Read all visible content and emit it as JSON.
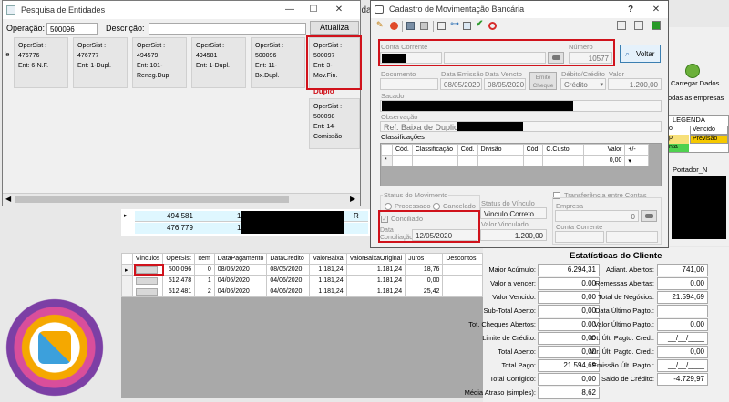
{
  "background_app": {
    "title_fragment": "lida",
    "right_panel": {
      "carregar_dados": "Carregar Dados",
      "todas_empresas": "odas as empresas",
      "legenda_title": "LEGENDA",
      "legenda_items": [
        "Vencido",
        "Previsão",
        "nta"
      ],
      "legend_left": [
        "o",
        "p"
      ],
      "portador_header": "Portador_N"
    },
    "mid_grid": {
      "rows": [
        {
          "value": "494.581",
          "qty": "1",
          "flag": "R"
        },
        {
          "value": "476.779",
          "qty": "1",
          "flag": ""
        }
      ],
      "row_marker": "▸"
    },
    "bottom_grid": {
      "columns": [
        "Vínculos",
        "OperSist",
        "Item",
        "DataPagamento",
        "DataCredito",
        "ValorBaixa",
        "ValorBaixaOriginal",
        "Juros",
        "Descontos"
      ],
      "rows": [
        {
          "opersist": "500.096",
          "item": "0",
          "datapag": "08/05/2020",
          "datacred": "08/05/2020",
          "valor": "1.181,24",
          "original": "1.181,24",
          "juros": "18,76",
          "desc": ""
        },
        {
          "opersist": "512.478",
          "item": "1",
          "datapag": "04/06/2020",
          "datacred": "04/06/2020",
          "valor": "1.181,24",
          "original": "1.181,24",
          "juros": "0,00",
          "desc": ""
        },
        {
          "opersist": "512.481",
          "item": "2",
          "datapag": "04/06/2020",
          "datacred": "04/06/2020",
          "valor": "1.181,24",
          "original": "1.181,24",
          "juros": "25,42",
          "desc": ""
        }
      ]
    },
    "stats": {
      "title": "Estatísticas do Cliente",
      "left": [
        {
          "label": "Maior Acúmulo:",
          "value": "6.294,31"
        },
        {
          "label": "Valor a vencer:",
          "value": "0,00"
        },
        {
          "label": "Valor Vencido:",
          "value": "0,00"
        },
        {
          "label": "Sub-Total Aberto:",
          "value": "0,00"
        },
        {
          "label": "Tot. Cheques Abertos:",
          "value": "0,00"
        },
        {
          "label": "Limite de Crédito:",
          "value": "0,00"
        },
        {
          "label": "Total Aberto:",
          "value": "0,00"
        },
        {
          "label": "Total Pago:",
          "value": "21.594,69"
        },
        {
          "label": "Total Corrigido:",
          "value": "0,00"
        },
        {
          "label": "Média Atraso (simples):",
          "value": "8,62"
        }
      ],
      "right": [
        {
          "label": "Adiant. Abertos:",
          "value": "741,00"
        },
        {
          "label": "Remessas Abertas:",
          "value": "0,00"
        },
        {
          "label": "Total de Negócios:",
          "value": "21.594,69"
        },
        {
          "label": "Data Último Pagto.:",
          "value": ""
        },
        {
          "label": "Valor Último Pagto.:",
          "value": "0,00"
        },
        {
          "label": "Dt. Últ. Pagto. Cred.:",
          "value": "__/__/____"
        },
        {
          "label": "Vlr. Últ. Pagto. Cred.:",
          "value": "0,00"
        },
        {
          "label": "Emissão Últ. Pagto.:",
          "value": "__/__/____"
        },
        {
          "label": "Saldo de Crédito:",
          "value": "-4.729,97"
        }
      ]
    }
  },
  "entidades": {
    "title": "Pesquisa de Entidades",
    "operacao_label": "Operação:",
    "operacao_value": "500096",
    "descricao_label": "Descrição:",
    "descricao_value": "",
    "atualiza_label": "Atualiza",
    "left_edge_text": "le",
    "cards": [
      {
        "opersist": "OperSist : 476776",
        "ent": "Ent: 6-N.F."
      },
      {
        "opersist": "OperSist : 476777",
        "ent": "Ent: 1-Dupl."
      },
      {
        "opersist": "OperSist : 494579",
        "ent": "Ent: 101-Reneg.Dup"
      },
      {
        "opersist": "OperSist : 494581",
        "ent": "Ent: 1-Dupl."
      },
      {
        "opersist": "OperSist : 500096",
        "ent": "Ent: 11-Bx.Dupl."
      },
      {
        "opersist": "OperSist : 500097",
        "ent": "Ent: 3-Mov.Fin."
      },
      {
        "opersist": "OperSist : 500098",
        "ent": "Ent: 14-Comissão"
      }
    ],
    "duplo_clique": "Duplo Clique"
  },
  "cadastro": {
    "title": "Cadastro de Movimentação Bancária",
    "help": "?",
    "close": "✕",
    "conta_corrente_label": "Conta Corrente",
    "numero_label": "Número",
    "numero_value": "10577",
    "voltar_label": "Voltar",
    "documento_label": "Documento",
    "data_emissao_label": "Data Emissão",
    "data_emissao_value": "08/05/2020",
    "data_vencto_label": "Data Vencto",
    "data_vencto_value": "08/05/2020",
    "emite_cheque_label": "Emite Cheque",
    "debito_credito_label": "Débito/Crédito",
    "debito_credito_value": "Crédito",
    "valor_label": "Valor",
    "valor_value": "1.200,00",
    "sacado_label": "Sacado",
    "observacao_label": "Observação",
    "observacao_value": "Ref. Baixa de Duplicata:",
    "classificacoes_label": "Classificações",
    "class_columns": [
      "Cód.",
      "Classificação",
      "Cód.",
      "Divisão",
      "Cód.",
      "C.Custo",
      "Valor",
      "+/-"
    ],
    "class_row_marker": "*",
    "class_row_value": "0,00",
    "status_label": "Status do Movimento",
    "processado_label": "Processado",
    "cancelado_label": "Cancelado",
    "conciliado_label": "Conciliado",
    "data_conciliacao_label": "Data Conciliação",
    "data_conciliacao_value": "12/05/2020",
    "status_vinculo_label": "Status do Vínculo",
    "status_vinculo_value": "Vinculo Correto",
    "valor_vinculado_label": "Valor Vinculado",
    "valor_vinculado_value": "1.200,00",
    "transferencia_label": "Transferência entre Contas",
    "empresa_label": "Empresa",
    "empresa_value": "0",
    "conta_corrente2_label": "Conta Corrente"
  },
  "colors": {
    "accent_red": "#d0121b",
    "selection_blue": "#cfe8ff",
    "grid_cyan": "#dff7ff"
  }
}
